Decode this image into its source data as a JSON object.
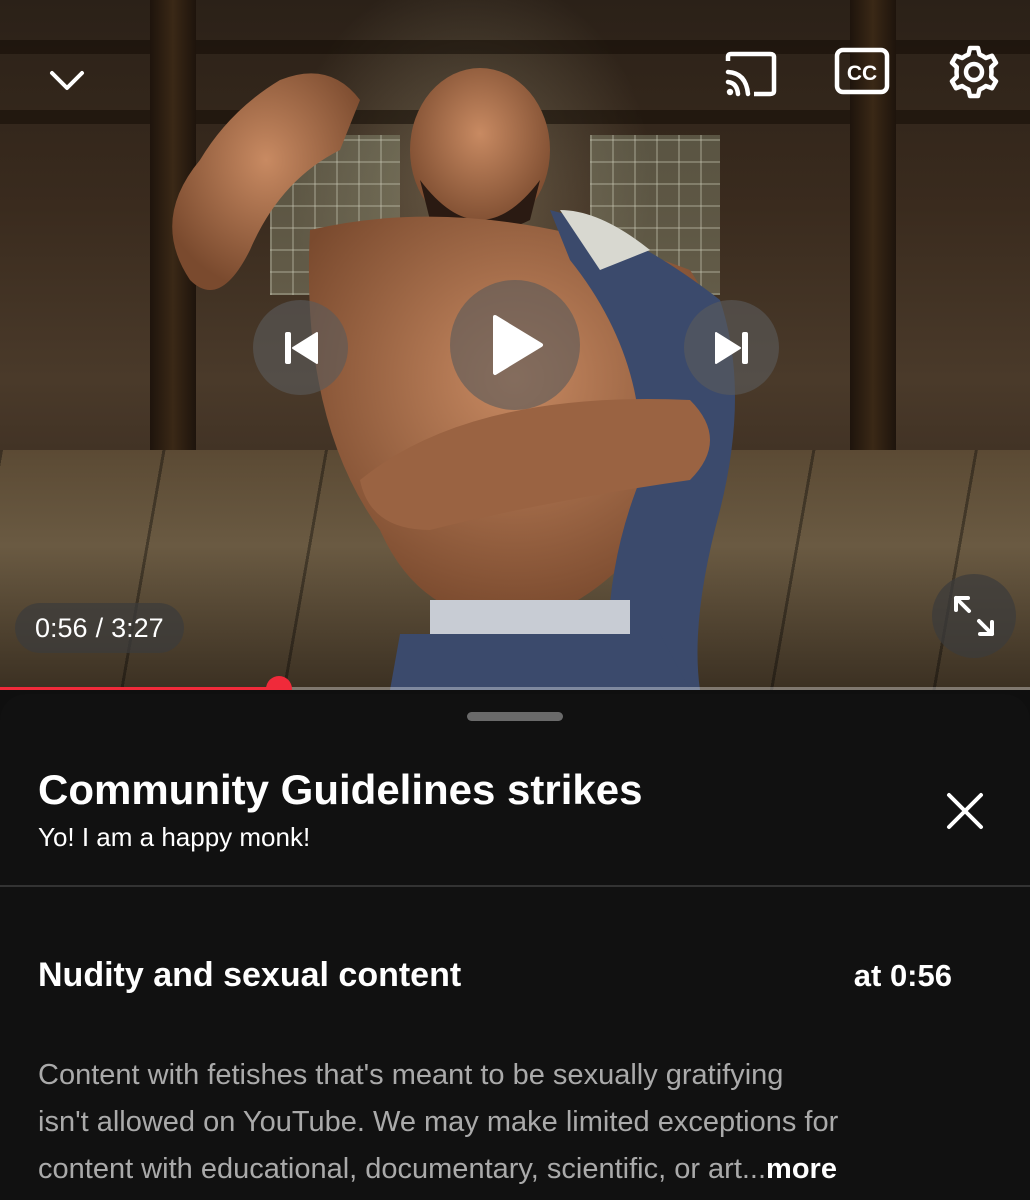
{
  "player": {
    "current_time": "0:56",
    "separator": "/",
    "duration": "3:27",
    "progress_fraction": 0.271,
    "icons": {
      "collapse": "chevron-down-icon",
      "cast": "cast-icon",
      "captions": "closed-captions-icon",
      "captions_text": "CC",
      "settings": "gear-icon",
      "previous": "skip-previous-icon",
      "play": "play-icon",
      "next": "skip-next-icon",
      "fullscreen": "fullscreen-icon"
    },
    "colors": {
      "progress": "#f02a3a"
    }
  },
  "sheet": {
    "title": "Community Guidelines strikes",
    "subtitle": "Yo! I am a happy monk!",
    "close_icon": "close-icon",
    "strike": {
      "heading": "Nudity and sexual content",
      "timestamp": "at 0:56",
      "description_lines": [
        "Content with fetishes that's meant to be sexually gratifying",
        "isn't allowed on YouTube. We may make limited exceptions for",
        "content with educational, documentary, scientific, or art..."
      ],
      "more_label": "more"
    }
  }
}
